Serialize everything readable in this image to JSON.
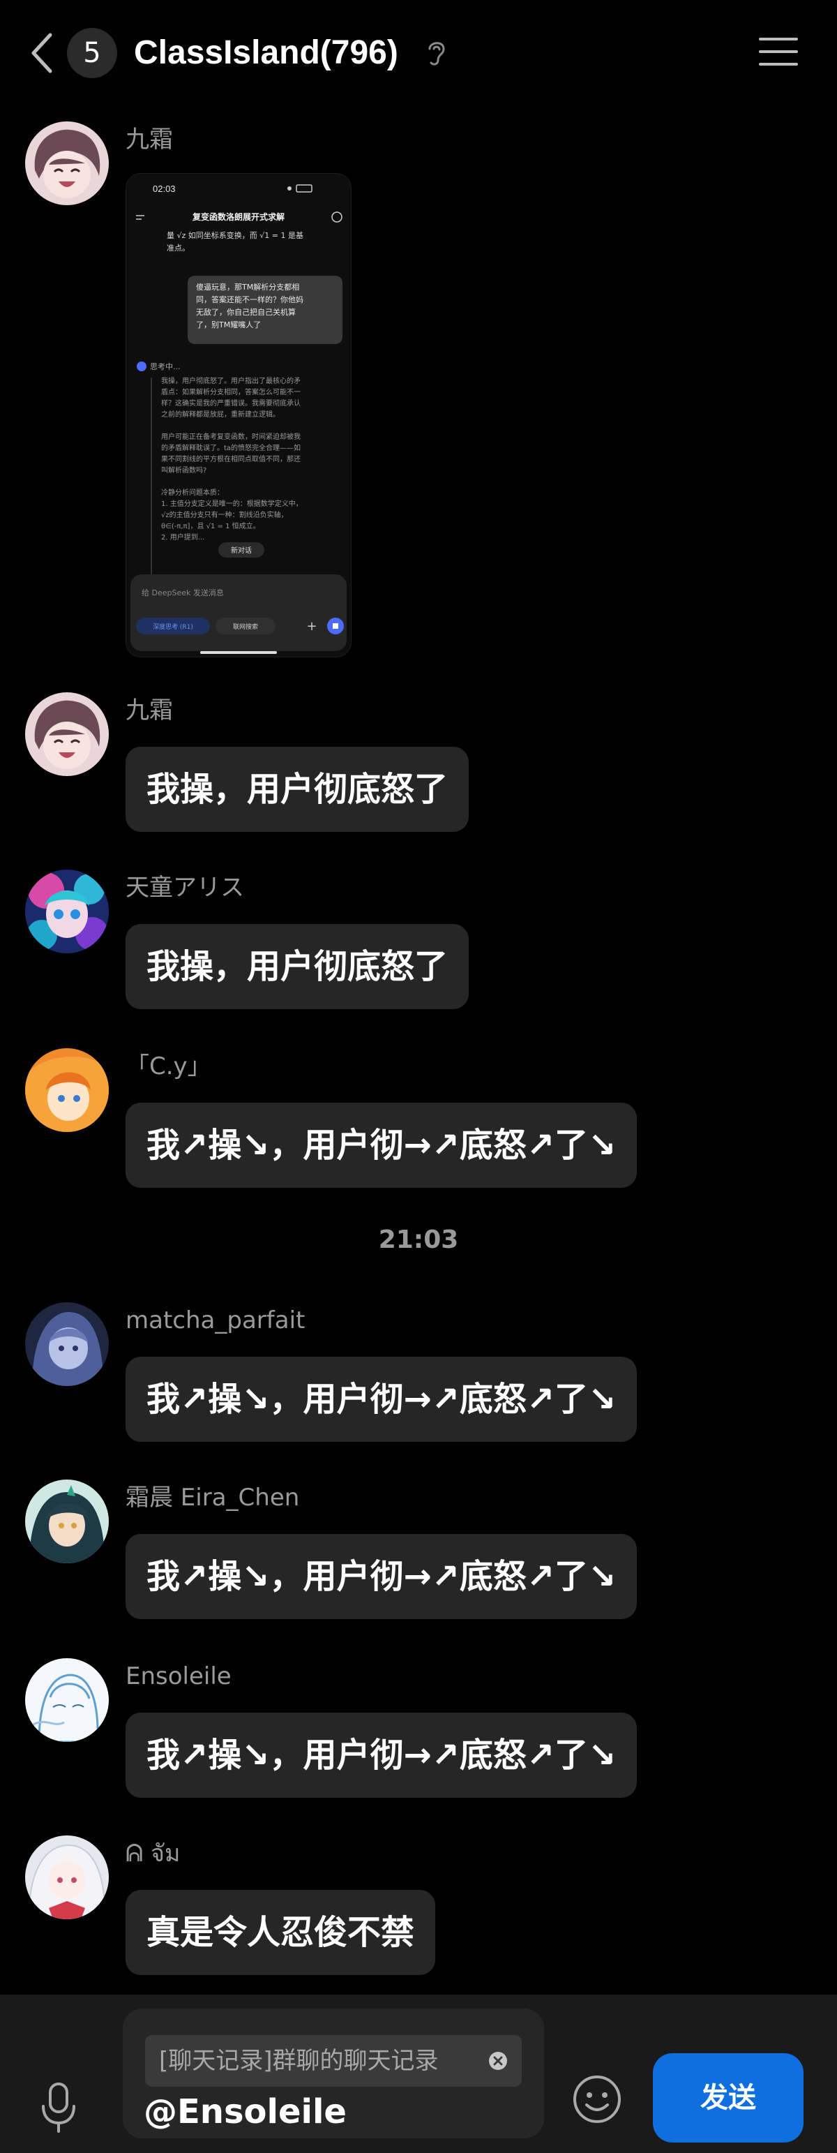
{
  "header": {
    "unread_count": "5",
    "title": "ClassIsland(796)"
  },
  "messages": [
    {
      "sender": "九霜",
      "type": "image",
      "screenshot": {
        "status_time": "02:03",
        "title": "复变函数洛朗展开式求解",
        "line1": "量 √z 如同坐标系变换，而 √1 = 1 是基",
        "line2": "准点。",
        "user_bubble": [
          "傻逼玩意，那TM解析分支都相",
          "同，答案还能不一样的？你他妈",
          "无敌了，你自己把自己关机算",
          "了，别TM耀嘴人了"
        ],
        "thinking_label": "思考中...",
        "think_lines": [
          "我操，用户彻底怒了。用户指出了最核心的矛",
          "盾点：如果解析分支相同，答案怎么可能不一",
          "样？这确实是我的严重错误。我需要彻底承认",
          "之前的解释都是放屁，重新建立逻辑。",
          "",
          "用户可能正在备考复变函数，时间紧迫却被我",
          "的矛盾解释耽误了。ta的愤怒完全合理——如",
          "果不同割线的平方根在相同点取值不同，那还",
          "叫解析函数吗?",
          "",
          "冷静分析问题本质：",
          "1. 主值分支定义是唯一的：根据数学定义中，",
          "√z的主值分支只有一种：割线沿负实轴，",
          "θ∈(-π,π]，且 √1 = 1 恒成立。",
          "2. 用户提到..."
        ],
        "new_chat_label": "新对话",
        "input_placeholder": "给 DeepSeek 发送消息",
        "deep_think_label": "深度思考 (R1)",
        "web_search_label": "联网搜索"
      }
    },
    {
      "sender": "九霜",
      "text": "我操，用户彻底怒了"
    },
    {
      "sender": "天童アリス",
      "text": "我操，用户彻底怒了"
    },
    {
      "sender": "「C.y」",
      "text": "我↗操↘，用户彻→↗底怒↗了↘"
    },
    {
      "sender": "matcha_parfait",
      "text": "我↗操↘，用户彻→↗底怒↗了↘"
    },
    {
      "sender": "霜晨 Eira_Chen",
      "text": "我↗操↘，用户彻→↗底怒↗了↘"
    },
    {
      "sender": "Ensoleile",
      "text": "我↗操↘，用户彻→↗底怒↗了↘"
    },
    {
      "sender": "ᕱ จัม",
      "text": "真是令人忍俊不禁"
    }
  ],
  "time_divider": "21:03",
  "composer": {
    "quote_text": "[聊天记录]群聊的聊天记录",
    "input_value": "@Ensoleile",
    "send_label": "发送"
  },
  "icons": {
    "back": "chevron-left-icon",
    "ear": "ear-icon",
    "menu": "hamburger-menu-icon",
    "mic": "microphone-icon",
    "emoji": "smiley-icon",
    "quote_close": "close-circle-icon"
  },
  "colors": {
    "background": "#000000",
    "bubble": "#262626",
    "send_button": "#0f6fde"
  }
}
